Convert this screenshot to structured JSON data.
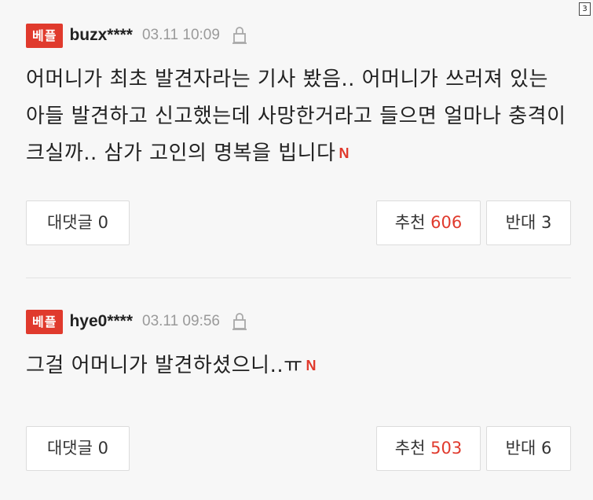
{
  "corner_badge": "3",
  "comments": [
    {
      "badge": "베플",
      "username": "buzx****",
      "timestamp": "03.11 10:09",
      "report_icon": "lock-icon",
      "body": "어머니가 최초 발견자라는 기사 봤음.. 어머니가 쓰러져 있는 아들 발견하고 신고했는데 사망한거라고 들으면 얼마나 충격이 크실까.. 삼가 고인의 명복을 빕니다",
      "n_mark": "N",
      "reply_label": "대댓글",
      "reply_count": "0",
      "like_label": "추천",
      "like_count": "606",
      "dislike_label": "반대",
      "dislike_count": "3"
    },
    {
      "badge": "베플",
      "username": "hye0****",
      "timestamp": "03.11 09:56",
      "report_icon": "lock-icon",
      "body": "그걸 어머니가 발견하셨으니..ㅠ",
      "n_mark": "N",
      "reply_label": "대댓글",
      "reply_count": "0",
      "like_label": "추천",
      "like_count": "503",
      "dislike_label": "반대",
      "dislike_count": "6"
    }
  ],
  "colors": {
    "accent": "#e03a2d",
    "timestamp": "#9a9a9a",
    "border": "#dcdcdc"
  }
}
